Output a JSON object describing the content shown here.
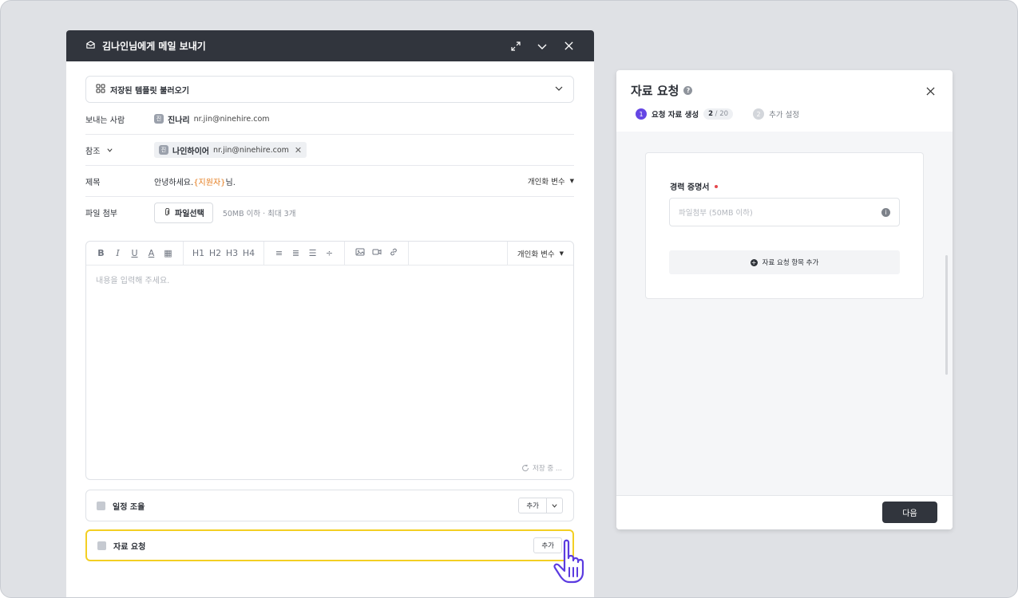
{
  "mail": {
    "title": "김나인님에게 메일 보내기",
    "template_label": "저장된 템플릿 불러오기",
    "from": {
      "label": "보내는 사람",
      "avatar": "진",
      "name": "진나리",
      "email": "nr.jin@ninehire.com"
    },
    "cc": {
      "label": "참조",
      "avatar": "진",
      "name": "나인하이어",
      "email": "nr.jin@ninehire.com"
    },
    "subject": {
      "label": "제목",
      "prefix": "안녕하세요. ",
      "variable": "{지원자}",
      "suffix": "님.",
      "var_select": "개인화 변수"
    },
    "attach": {
      "label": "파일 첨부",
      "button": "파일선택",
      "hint": "50MB 이하 · 최대 3개"
    },
    "editor": {
      "toolbar": {
        "format": [
          "B",
          "I",
          "U",
          "A",
          "▦"
        ],
        "headings": [
          "H1",
          "H2",
          "H3",
          "H4"
        ],
        "lists": [
          "≡",
          "≣",
          "☰",
          "÷"
        ]
      },
      "var_select": "개인화 변수",
      "placeholder": "내용을 입력해 주세요.",
      "saving": "저장 중 ..."
    },
    "schedule": {
      "label": "일정 조율",
      "add": "추가"
    },
    "request": {
      "label": "자료 요청",
      "add": "추가"
    }
  },
  "panel": {
    "title": "자료 요청",
    "steps": [
      {
        "num": "1",
        "label": "요청 자료 생성",
        "count": "2",
        "total": "20"
      },
      {
        "num": "2",
        "label": "추가 설정"
      }
    ],
    "field": {
      "label": "경력 증명서",
      "placeholder": "파일첨부 (50MB 이하)"
    },
    "add_item": "자료 요청 항목 추가",
    "next": "다음"
  },
  "colors": {
    "header": "#31353d",
    "accent": "#6546e4",
    "highlight": "#f3cf23",
    "variable": "#e47b1c",
    "required": "#e5484d"
  }
}
